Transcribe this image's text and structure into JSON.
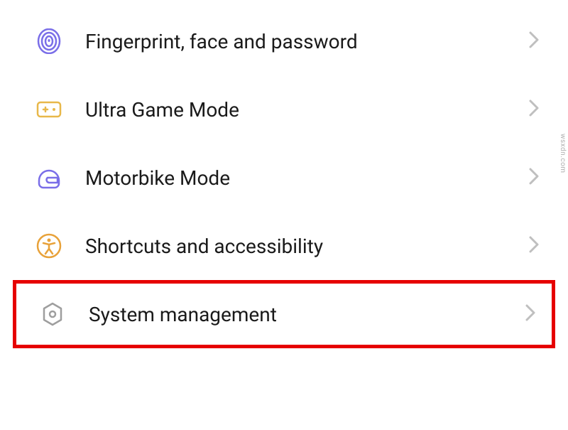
{
  "settings": {
    "items": [
      {
        "id": "fingerprint",
        "label": "Fingerprint, face and password"
      },
      {
        "id": "ultra-game",
        "label": "Ultra Game Mode"
      },
      {
        "id": "motorbike",
        "label": "Motorbike Mode"
      },
      {
        "id": "shortcuts",
        "label": "Shortcuts and accessibility"
      },
      {
        "id": "system",
        "label": "System management"
      }
    ]
  },
  "watermark": "wsxdn.com"
}
